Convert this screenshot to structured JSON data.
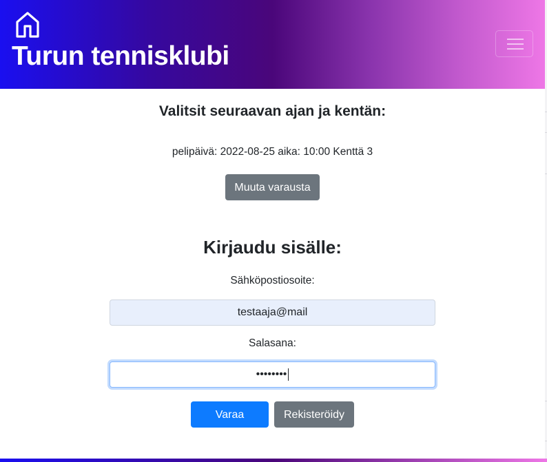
{
  "navbar": {
    "brand": "Turun tennisklubi",
    "home_icon": "home-icon",
    "menu_icon": "hamburger-menu-icon"
  },
  "selection": {
    "heading": "Valitsit seuraavan ajan ja kentän:",
    "details": "pelipäivä: 2022-08-25 aika: 10:00 Kenttä 3",
    "change_button": "Muuta varausta"
  },
  "login": {
    "heading": "Kirjaudu sisälle:",
    "email_label": "Sähköpostiosoite:",
    "email_value": "testaaja@mail",
    "password_label": "Salasana:",
    "password_masked": "••••••••",
    "submit_button": "Varaa",
    "register_button": "Rekisteröidy"
  },
  "colors": {
    "header_gradient_start": "#1a0ff0",
    "header_gradient_mid": "#4a067a",
    "header_gradient_end": "#ee77e6",
    "primary_button": "#0d7bff",
    "secondary_button": "#6c757d"
  }
}
